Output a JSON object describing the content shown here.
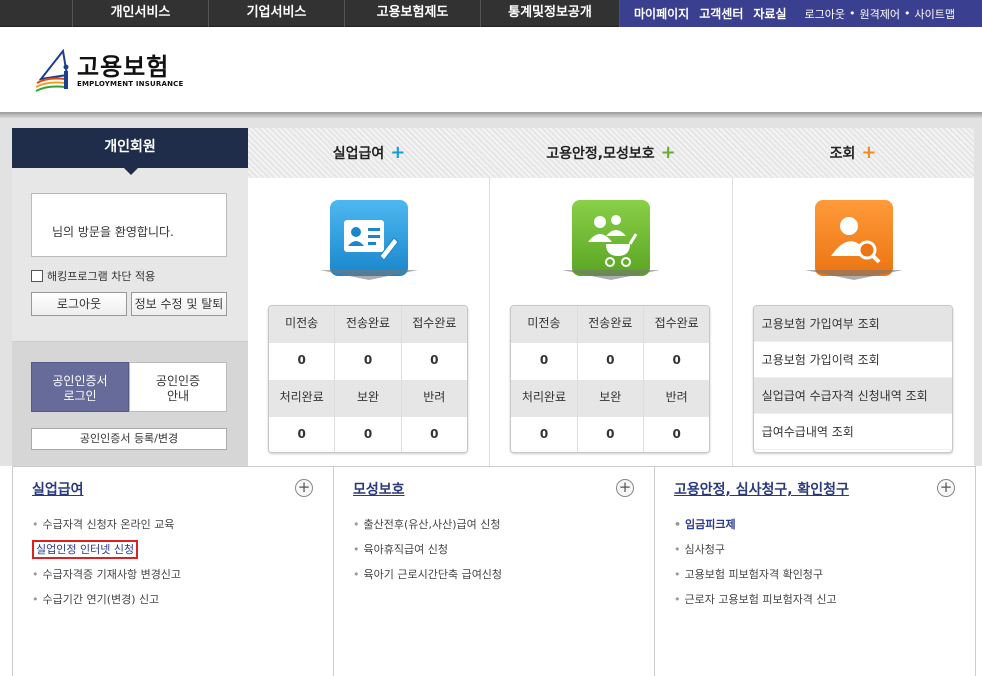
{
  "topnav": {
    "items": [
      "개인서비스",
      "기업서비스",
      "고용보험제도",
      "통계및정보공개"
    ],
    "right_items": [
      "마이페이지",
      "고객센터",
      "자료실"
    ],
    "small_links": [
      "로그아웃",
      "원격제어",
      "사이트맵"
    ]
  },
  "logo": {
    "kor": "고용보험",
    "eng": "EMPLOYMENT INSURANCE"
  },
  "left_panel": {
    "title": "개인회원",
    "welcome": "님의 방문을 환영합니다.",
    "hacking_checkbox": "해킹프로그램 차단 적용",
    "logout_button": "로그아웃",
    "edit_button": "정보 수정 및 탈퇴",
    "cert_login": [
      "공인인증서",
      "로그인"
    ],
    "cert_info": [
      "공인인증",
      "안내"
    ],
    "cert_register": "공인인증서 등록/변경"
  },
  "tabs": [
    {
      "label": "실업급여",
      "plus_color": "#1a9ad6"
    },
    {
      "label": "고용안정,모성보호",
      "plus_color": "#6aad2a"
    },
    {
      "label": "조회",
      "plus_color": "#f08a20"
    }
  ],
  "stats": [
    {
      "header1": [
        "미전송",
        "전송완료",
        "접수완료"
      ],
      "values1": [
        "0",
        "0",
        "0"
      ],
      "header2": [
        "처리완료",
        "보완",
        "반려"
      ],
      "values2": [
        "0",
        "0",
        "0"
      ]
    },
    {
      "header1": [
        "미전송",
        "전송완료",
        "접수완료"
      ],
      "values1": [
        "0",
        "0",
        "0"
      ],
      "header2": [
        "처리완료",
        "보완",
        "반려"
      ],
      "values2": [
        "0",
        "0",
        "0"
      ]
    }
  ],
  "query_items": [
    "고용보험 가입여부 조회",
    "고용보험 가입이력 조회",
    "실업급여 수급자격 신청내역 조회",
    "급여수급내역 조회"
  ],
  "bottom": [
    {
      "title": "실업급여",
      "items": [
        "수급자격 신청자 온라인 교육",
        "실업인정 인터넷 신청",
        "수급자격증 기재사항 변경신고",
        "수급기간 연기(변경) 신고"
      ]
    },
    {
      "title": "모성보호",
      "items": [
        "출산전후(유산,사산)급여 신청",
        "육아휴직급여 신청",
        "육아기 근로시간단축 급여신청"
      ]
    },
    {
      "title": "고용안정, 심사청구, 확인청구",
      "items": [
        "임금피크제",
        "심사청구",
        "고용보험 피보험자격 확인청구",
        "근로자 고용보험 피보험자격 신고"
      ]
    }
  ],
  "colors": {
    "icon_blue": "#2a9de0",
    "icon_green": "#6cb832",
    "icon_orange": "#f58220",
    "highlight_box": "#e02020"
  }
}
